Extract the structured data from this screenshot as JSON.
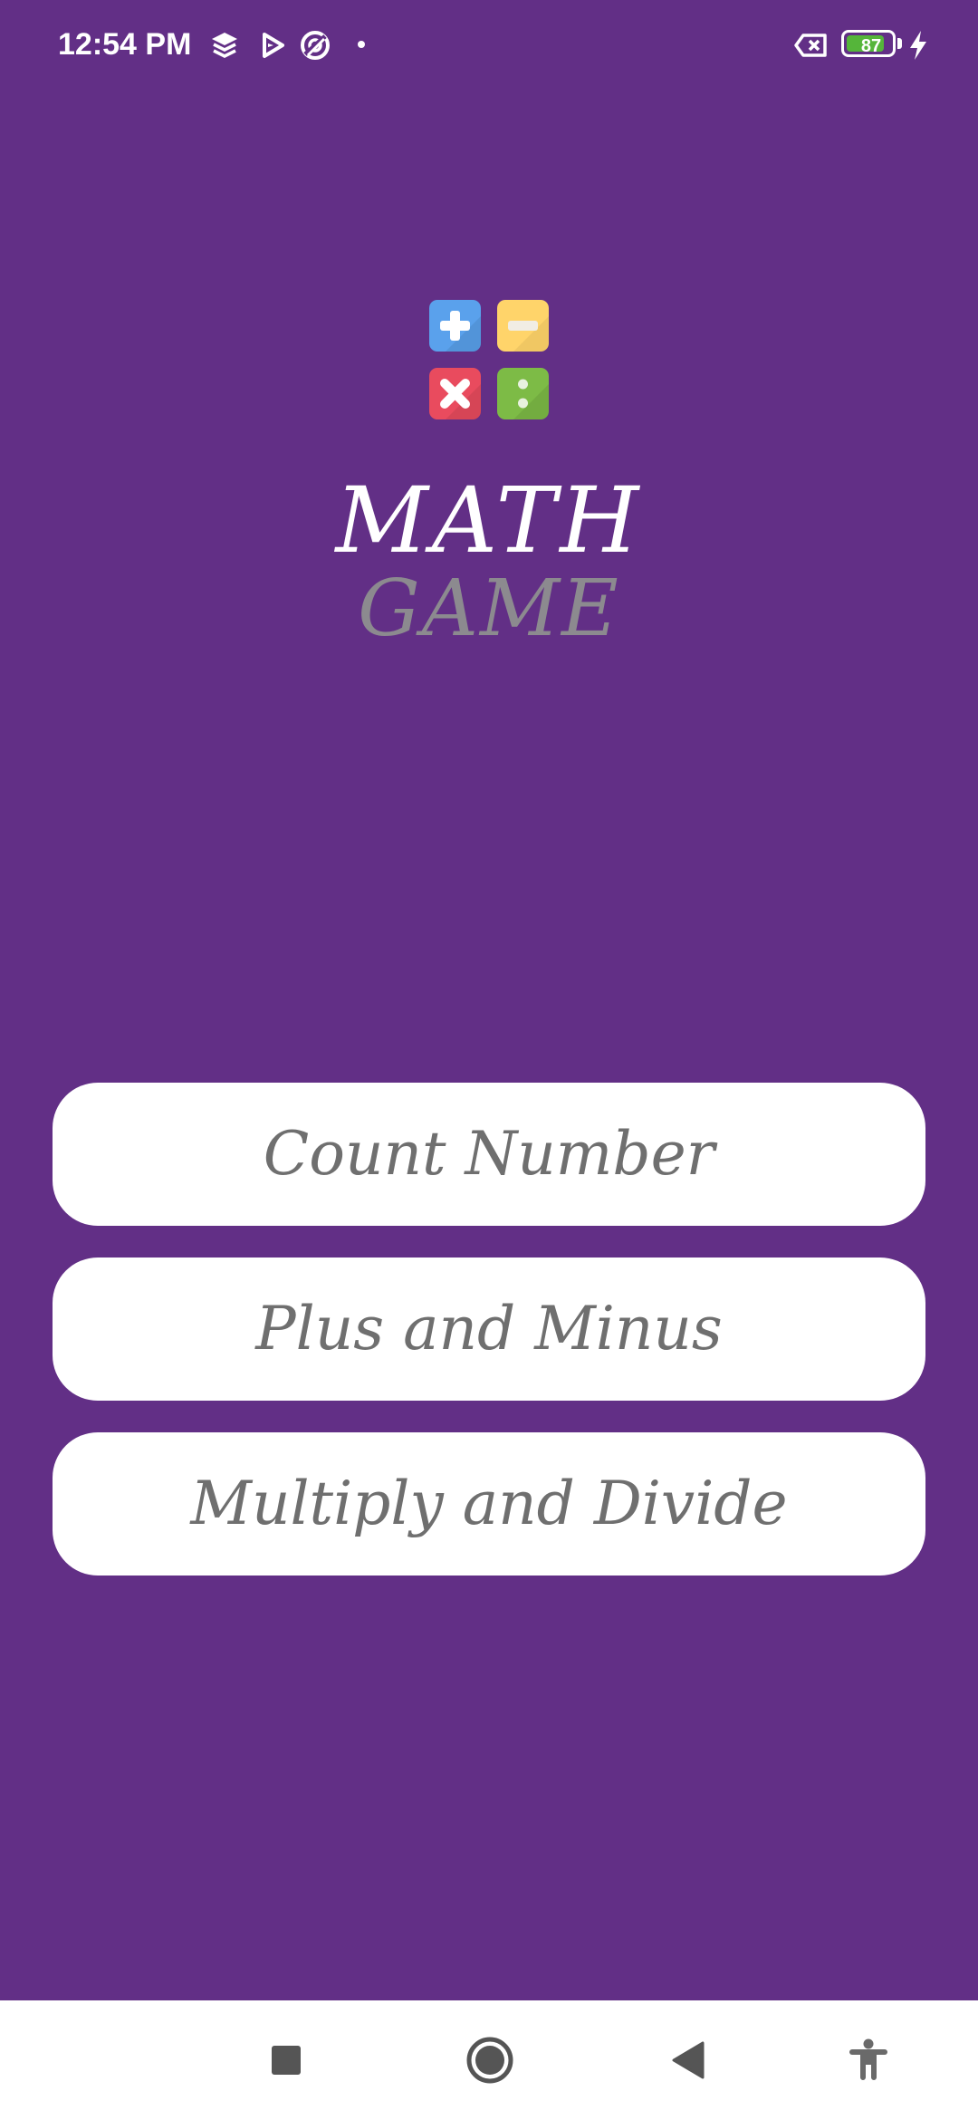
{
  "status_bar": {
    "time": "12:54 PM",
    "icons": [
      "layers-icon",
      "play-store-icon",
      "sync-icon",
      "notification-dot",
      "sim-off-icon",
      "battery-icon",
      "charging-bolt-icon"
    ],
    "battery_percent": "87",
    "battery_level": 0.87,
    "battery_color": "#55b53a"
  },
  "logo": {
    "tiles": [
      {
        "name": "plus-icon",
        "color": "#5aa1ec"
      },
      {
        "name": "minus-icon",
        "color": "#ffd46a"
      },
      {
        "name": "multiply-icon",
        "color": "#e94b5e"
      },
      {
        "name": "divide-icon",
        "color": "#7dbb46"
      }
    ]
  },
  "title": {
    "line1": "MATH",
    "line2": "GAME"
  },
  "menu": {
    "buttons": [
      {
        "label": "Count Number"
      },
      {
        "label": "Plus and Minus"
      },
      {
        "label": "Multiply and Divide"
      }
    ]
  },
  "nav_bar": {
    "icons": [
      "recents-icon",
      "home-icon",
      "back-icon",
      "accessibility-icon"
    ]
  },
  "colors": {
    "background": "#622f86",
    "button_background": "#ffffff",
    "button_text": "#6f6f6f",
    "title_primary": "#ffffff",
    "title_secondary": "#8c8a8f"
  }
}
